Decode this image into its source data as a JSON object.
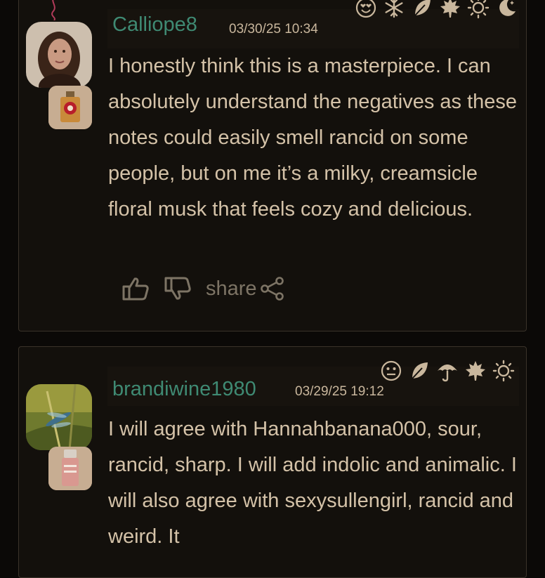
{
  "reviews": [
    {
      "username": "Calliope8",
      "date": "03/30/25 10:34",
      "text": "I honestly think this is a masterpiece. I can absolutely understand the negatives as these notes could easily smell rancid on some people, but on me it’s a milky, creamsicle floral musk that feels cozy and delicious.",
      "icons": [
        "love-icon",
        "snowflake-icon",
        "leaf-icon",
        "maple-leaf-icon",
        "sun-icon",
        "moon-icon"
      ],
      "share_label": "share"
    },
    {
      "username": "brandiwine1980",
      "date": "03/29/25 19:12",
      "text": "I will agree with Hannahbanana000, sour, rancid, sharp. I will add indolic and animalic. I will also agree with sexysullengirl, rancid and weird. It",
      "icons": [
        "neutral-face-icon",
        "leaf-icon",
        "umbrella-icon",
        "maple-leaf-icon",
        "sun-icon"
      ]
    }
  ],
  "colors": {
    "username": "#3f8a73",
    "text": "#d4c2a8",
    "muted": "#7d7465",
    "card_bg": "#13100c",
    "border": "#3a332a"
  }
}
